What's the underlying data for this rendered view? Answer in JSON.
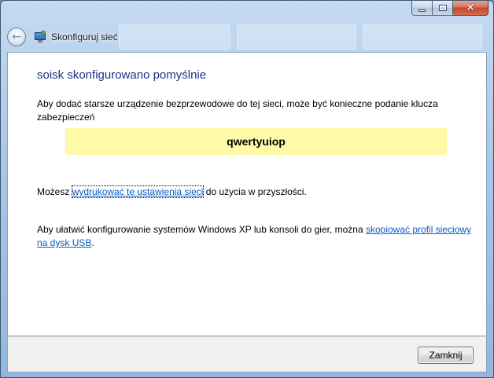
{
  "window": {
    "title": "Skonfiguruj sieć"
  },
  "content": {
    "heading": "soisk skonfigurowano pomyślnie",
    "intro_text": "Aby dodać starsze urządzenie bezprzewodowe do tej sieci, może być konieczne podanie klucza zabezpieczeń",
    "security_key": "qwertyuiop",
    "print_prefix": "Możesz ",
    "print_link": "wydrukować te ustawienia sieci",
    "print_suffix": " do użycia w przyszłości.",
    "usb_prefix": "Aby ułatwić konfigurowanie systemów Windows XP lub konsoli do gier, można ",
    "usb_link": "skopiować profil sieciowy na dysk USB",
    "usb_suffix": "."
  },
  "footer": {
    "close_label": "Zamknij"
  },
  "icons": {
    "back": "back-arrow-icon",
    "wizard": "network-wizard-icon",
    "minimize": "minimize-icon",
    "maximize": "maximize-icon",
    "close": "close-icon"
  },
  "colors": {
    "heading": "#1e3287",
    "link": "#0a5bc4",
    "key_highlight": "#fff9a8",
    "close_button_red": "#c4472c"
  }
}
